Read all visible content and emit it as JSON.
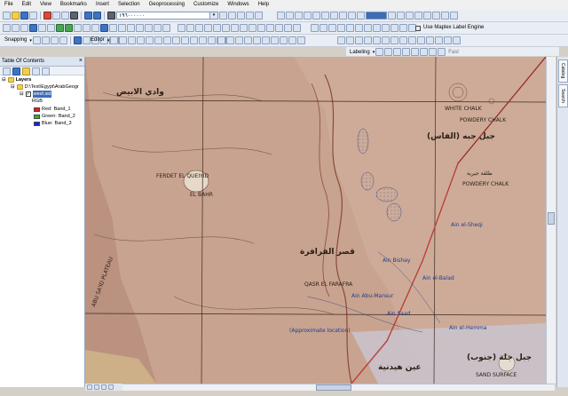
{
  "menu": [
    "File",
    "Edit",
    "View",
    "Bookmarks",
    "Insert",
    "Selection",
    "Geoprocessing",
    "Customize",
    "Windows",
    "Help"
  ],
  "toolbar": {
    "scale_value": "١٩٦٠٠٠٠٠٠",
    "selected_layer": "",
    "georef_label": "Use Maplex Label Engine",
    "snapping_label": "Snapping",
    "editor_label": "Editor",
    "labeling_label": "Labeling",
    "fast_label": "Fast"
  },
  "toc": {
    "title": "Table Of Contents",
    "root": "Layers",
    "folder": "D:\\Test\\Egypt\\ArabGeogr",
    "layer": "wesf.sid",
    "rgb": "RGB",
    "bands": [
      {
        "label": "Red:",
        "band": "Band_1",
        "color": "#e02020"
      },
      {
        "label": "Green:",
        "band": "Band_2",
        "color": "#20c020"
      },
      {
        "label": "Blue:",
        "band": "Band_3",
        "color": "#2020e0"
      }
    ]
  },
  "dock": {
    "catalog": "Catalog",
    "search": "Search"
  },
  "map_labels": {
    "wadi": "وادي الابيض",
    "white_chalk": "WHITE CHALK",
    "powdery_chalk_top": "POWDERY CHALK",
    "powdery_chalk": "POWDERY CHALK",
    "jebel_arabic": "جبل جبه (الفاس)",
    "halqa": "طلقة جيرية",
    "ferdet": "FERDET EL QUEIYID",
    "el_bahr": "EL BAHR",
    "qasr_arabic": "قصر الفرافرة",
    "qasr": "QASR EL FARAFRA",
    "ain_sheqi": "Ain el-Sheqi",
    "ain_bishay": "Ain Bishay",
    "ain_abu": "Ain Abu-Mansur",
    "ain_balad": "Ain el-Balad",
    "ain_saad": "Ain Saad",
    "ain_hemma": "Ain el-Hemma",
    "approx": "(Approximate location)",
    "plateau": "ABU SA'ID PLATEAU",
    "gebel_bottom": "جبل جلة (جنوب)",
    "sandy_bottom": "SAND SURFACE",
    "ain_bottom": "عين هيدنية"
  },
  "colors": {
    "map_base": "#c59d89",
    "toc_bg": "#ffffff",
    "toolbar_bg": "#e9edf4"
  }
}
